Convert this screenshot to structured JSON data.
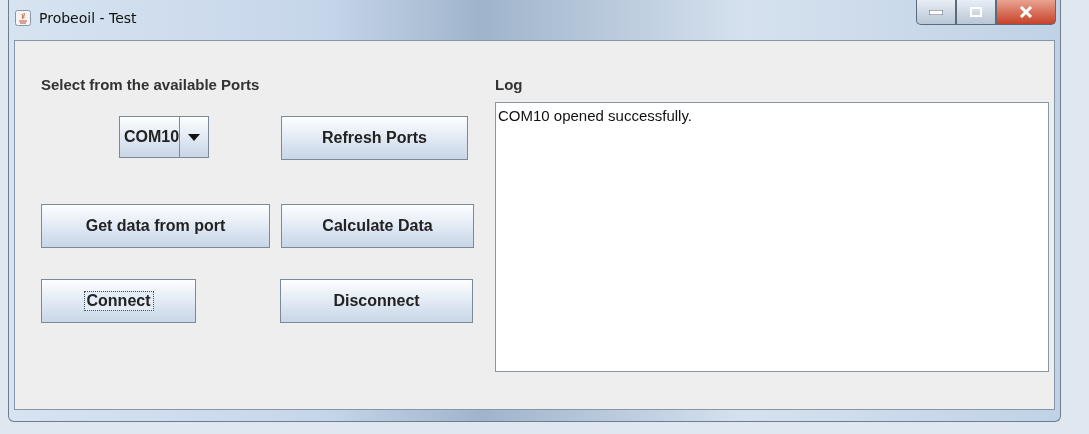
{
  "window": {
    "title": "Probeoil - Test"
  },
  "ports": {
    "label": "Select from the available Ports",
    "combo": {
      "value": "COM10"
    }
  },
  "buttons": [
    {
      "label": "Refresh Ports",
      "focused": false
    },
    {
      "label": "Get data from port",
      "focused": false
    },
    {
      "label": "Calculate Data",
      "focused": false
    },
    {
      "label": "Connect",
      "focused": true
    },
    {
      "label": "Disconnect",
      "focused": false
    }
  ],
  "log": {
    "label": "Log",
    "lines": [
      "COM10 opened successfully."
    ]
  }
}
